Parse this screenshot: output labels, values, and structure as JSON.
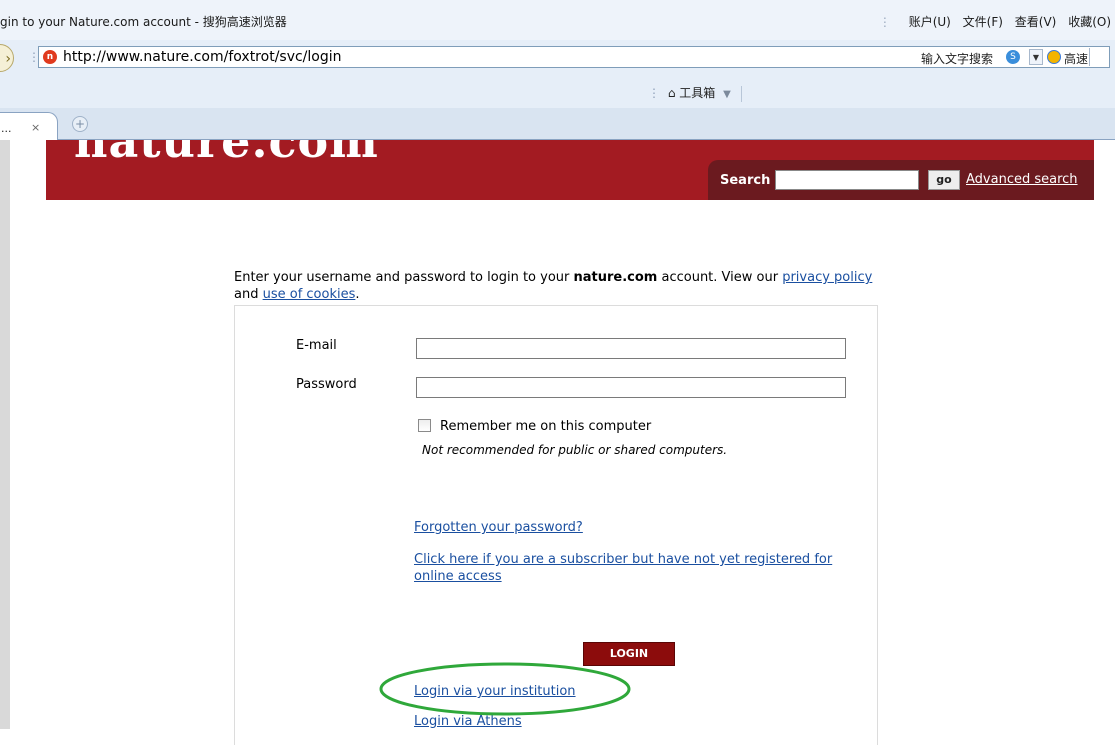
{
  "browser": {
    "window_title": "gin to your Nature.com account - 搜狗高速浏览器",
    "menu": [
      "账户(U)",
      "文件(F)",
      "查看(V)",
      "收藏(O)"
    ],
    "url": "http://www.nature.com/foxtrot/svc/login",
    "search_hint": "输入文字搜索",
    "speed_label": "高速",
    "toolbox_label": "工具箱",
    "tab_title": "...",
    "tab_close": "×"
  },
  "header": {
    "logo_text": "nature.com",
    "search_label": "Search",
    "search_value": "",
    "go_label": "go",
    "advanced_search": "Advanced search",
    "brand_color": "#a31b22",
    "strip_color": "#6b1a1f"
  },
  "intro": {
    "text_before": "Enter your username and password to login to your ",
    "brand": "nature.com",
    "text_middle": " account. View our ",
    "privacy_link": "privacy policy",
    "text_and": " and ",
    "cookies_link": "use of cookies",
    "text_end": "."
  },
  "form": {
    "email_label": "E-mail",
    "email_value": "",
    "password_label": "Password",
    "password_value": "",
    "remember_label": "Remember me on this computer",
    "remember_checked": false,
    "remember_note": "Not recommended for public or shared computers.",
    "forgot_link": "Forgotten your password?",
    "subscriber_link": "Click here if you are a subscriber but have not yet registered for online access",
    "login_button": "LOGIN",
    "institution_link": "Login via your institution",
    "athens_link": "Login via Athens"
  },
  "annotation": {
    "color": "#2fa83a",
    "shape": "ellipse"
  }
}
